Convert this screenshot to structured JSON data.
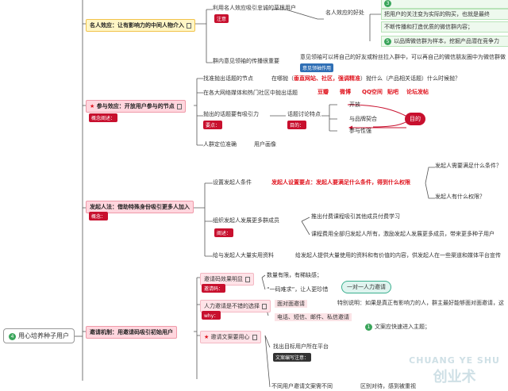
{
  "root": {
    "label": "用心培养种子用户",
    "badge": "4"
  },
  "branches": {
    "b1": {
      "title": "名人效应：让有影响力的中间人物介入",
      "n1": "利用名人效应吸引忠诚的草根用户",
      "n1_tag": "注意",
      "n1_child": "名人效应的好处",
      "benefits": [
        "3",
        "把用户的关注变为实际的购买，也就是最终",
        "不断传播和打造优质的微信群内容；",
        "5",
        "以品牌微信群为样本，挖掘产品潜在竞争力"
      ],
      "n2": "群内意见领袖的传播很重要",
      "n2_child": "意见领袖可以将自己的好友或粉丝拉入群中，可以再自己的微信朋友圈中为微信群做",
      "n2_tag": "意见领袖作用"
    },
    "b2": {
      "title": "参与效应：开放用户参与的节点",
      "sub_tag": "概念阐述：",
      "a1": "找准抛出话题的节点",
      "a1_mid": "在哪抛（垂直网站、社区，强调精准）抛什么（产品相关话题）什么时候抛？",
      "a1_mid_prefix": "在哪抛（",
      "a1_red": "垂直网站、社区，强调精准",
      "a1_suffix": "）抛什么（产品相关话题）什么时候抛？",
      "a2": "在各大网络媒体和热门社区中抛出话题",
      "a2_items": [
        "豆瓣",
        "微博",
        "QQ空间",
        "贴吧",
        "论坛发帖"
      ],
      "a3": "抛出的话题要有吸引力",
      "a3_tag": "要点：",
      "a3_mid": "话题讨论特点",
      "a3_mid_tag": "目的：",
      "a3_items": [
        "开放",
        "与品牌契合",
        "参与性强"
      ],
      "goal": "目的",
      "a4": "人群定位准确",
      "a4_child": "用户画像"
    },
    "b3": {
      "title": "发起人法：借助特殊身份吸引更多人加入",
      "sub_tag": "概念：",
      "c1": "设置发起人条件",
      "c1_mid": "发起人设置要点：发起人要满足什么条件，得到什么权限",
      "c1_r1": "发起人需要满足什么条件？",
      "c1_r2": "发起人有什么权限？",
      "c2": "组织发起人发展更多群成员",
      "c2_tag": "阐述：",
      "c2_r1": "推出付费课程吸引其他成员付费学习",
      "c2_r2": "课程费用全部归发起人所有，激励发起人发展更多成员，带来更多种子用户",
      "c3": "给与发起人大量实用资料",
      "c3_r": "给发起人提供大量使用的资料和有价值的内容，供发起人在一些渠道和媒体平台宣传"
    },
    "b4": {
      "title": "邀请机制：用邀请码吸引初始用户",
      "d1": "邀请码效果明显",
      "d1_tag": "邀请码：",
      "d1_r1": "数量有限，有稀缺感；",
      "d1_r2": "“一码难求”，让人更珍惜",
      "bubble": "一对一人力邀请",
      "d2": "人力邀请是不错的选择",
      "d2_tag": "why：",
      "d2_r1": "面对面邀请",
      "d2_r2": "电话、短信、邮件、私信邀请",
      "d2_note": "特别说明：如果是真正有影响力的人，群主最好能够面对面邀请，这",
      "d3": "邀请文案要用心",
      "d3_r1": "找出目标用户所在平台",
      "d3_r1_tag": "文案编写注意：",
      "d3_r2": "不同用户邀请文案需不同",
      "d3_items": [
        "1",
        "文案应快速进入主题；",
        "区别对待，感到被重视"
      ]
    }
  },
  "watermark": {
    "line1": "CHUANG YE SHU",
    "line2": "创业术"
  }
}
